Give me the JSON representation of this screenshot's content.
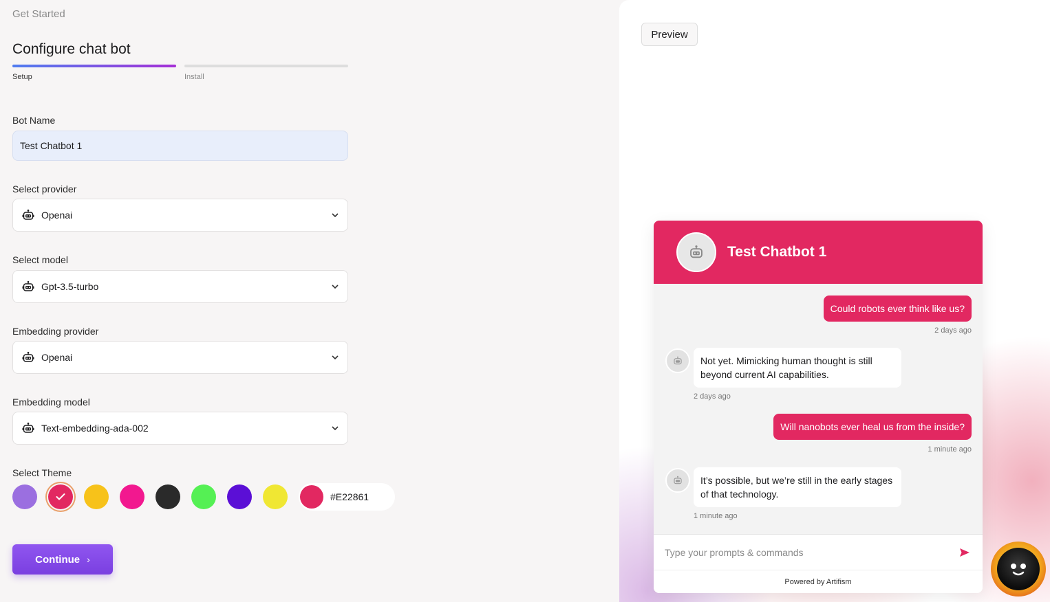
{
  "header": {
    "breadcrumb": "Get Started",
    "title": "Configure chat bot"
  },
  "steps": [
    {
      "label": "Setup",
      "active": true
    },
    {
      "label": "Install",
      "active": false
    }
  ],
  "form": {
    "bot_name": {
      "label": "Bot Name",
      "value": "Test Chatbot 1"
    },
    "provider": {
      "label": "Select provider",
      "value": "Openai",
      "icon": "robot-icon"
    },
    "model": {
      "label": "Select model",
      "value": "Gpt-3.5-turbo",
      "icon": "robot-icon"
    },
    "embedding_provider": {
      "label": "Embedding provider",
      "value": "Openai",
      "icon": "robot-icon"
    },
    "embedding_model": {
      "label": "Embedding model",
      "value": "Text-embedding-ada-002",
      "icon": "robot-icon"
    },
    "theme": {
      "label": "Select Theme",
      "swatches": [
        "#9b6fe0",
        "#E22861",
        "#f7c21a",
        "#f2188f",
        "#2a2a2a",
        "#55f054",
        "#5b0fd6",
        "#f0e733"
      ],
      "selected_index": 1,
      "custom_value": "#E22861"
    }
  },
  "actions": {
    "continue_label": "Continue"
  },
  "preview": {
    "button_label": "Preview",
    "chat": {
      "title": "Test Chatbot 1",
      "accent": "#E22861",
      "messages": [
        {
          "from": "user",
          "text": "Could robots ever think like us?",
          "time": "2 days ago"
        },
        {
          "from": "bot",
          "text": "Not yet. Mimicking human thought is still beyond current AI capabilities.",
          "time": "2 days ago"
        },
        {
          "from": "user",
          "text": "Will nanobots ever heal us from the inside?",
          "time": "1 minute ago"
        },
        {
          "from": "bot",
          "text": "It’s possible, but we’re still in the early stages of that technology.",
          "time": "1 minute ago"
        }
      ],
      "input_placeholder": "Type your prompts & commands",
      "powered_by": "Powered by Artifism"
    },
    "launcher_icon": "bot-face-icon"
  }
}
